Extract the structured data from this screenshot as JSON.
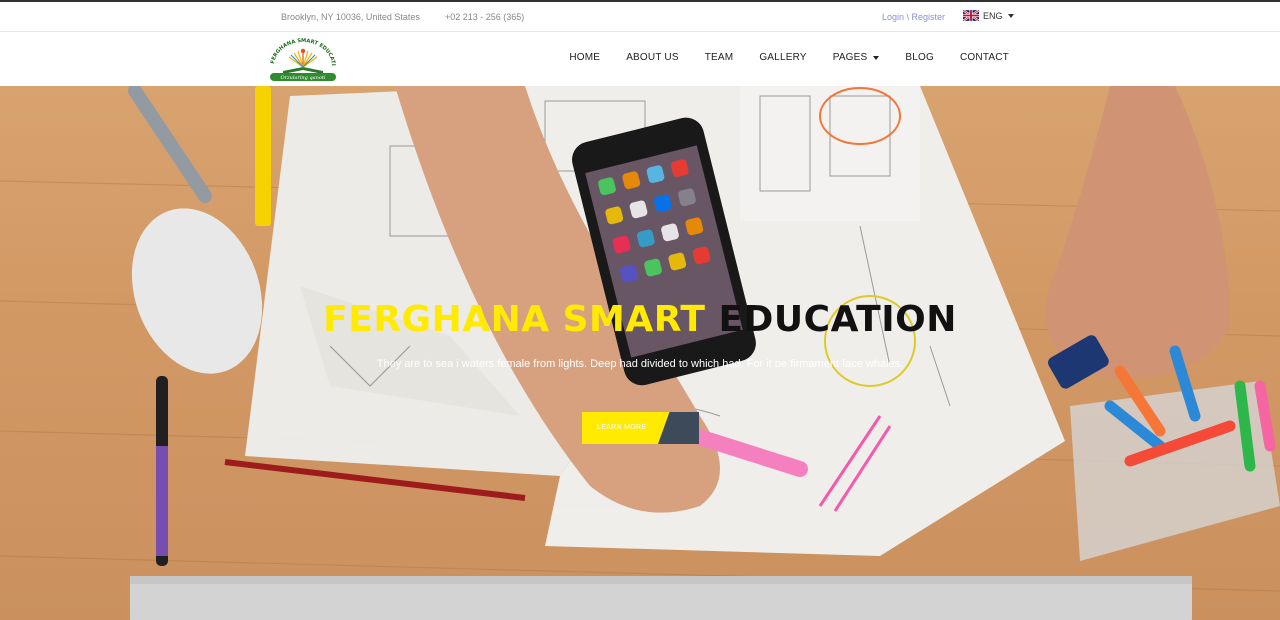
{
  "topbar": {
    "address": "Brooklyn, NY 10036, United States",
    "phone": "+02 213 - 256 (365)",
    "login": "Login \\ Register",
    "language": "ENG",
    "flag_icon": "uk-flag-icon"
  },
  "logo": {
    "arc_text": "FERGHANA SMART EDUCATION",
    "ribbon_text": "Orzularing   qanoti"
  },
  "nav": {
    "items": [
      "HOME",
      "ABOUT US",
      "TEAM",
      "GALLERY",
      "PAGES",
      "BLOG",
      "CONTACT"
    ],
    "dropdown_icon": "caret-down-icon"
  },
  "hero": {
    "title_highlight": "FERGHANA SMART",
    "title_rest": "EDUCATION",
    "subtitle": "They are to sea i waters female from lights. Deep had divided to which had. For it be firmament face whales.",
    "button": "LEARN MORE",
    "colors": {
      "highlight": "#ffea00",
      "dark": "#3d4a5a"
    }
  }
}
